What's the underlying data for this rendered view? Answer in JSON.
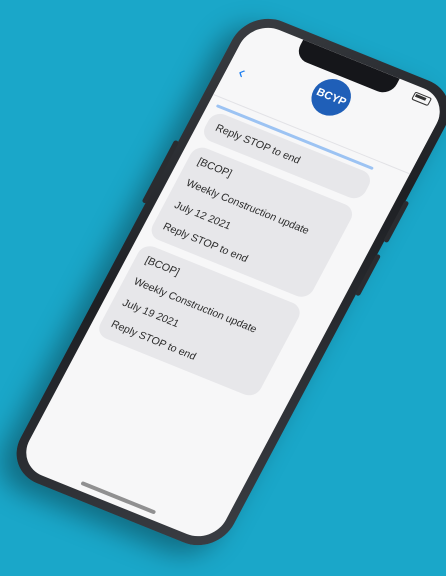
{
  "page": {
    "background": "#1aa7c9"
  },
  "status": {
    "time": ""
  },
  "header": {
    "avatar_text": "BCYP",
    "contact_name": ""
  },
  "thread": {
    "messages": [
      {
        "lines": [
          "Reply STOP to end"
        ],
        "link": "",
        "suffix": ""
      },
      {
        "timestamp": ""
      },
      {
        "lines": [
          "[BCOP]",
          "Weekly Construction update",
          "July 12 2021"
        ],
        "link": "",
        "suffix": "Reply STOP to end"
      },
      {
        "timestamp": ""
      },
      {
        "lines": [
          "[BCOP]",
          "Weekly Construction update",
          "July 19 2021"
        ],
        "link": "",
        "suffix": "Reply STOP to end"
      }
    ]
  }
}
